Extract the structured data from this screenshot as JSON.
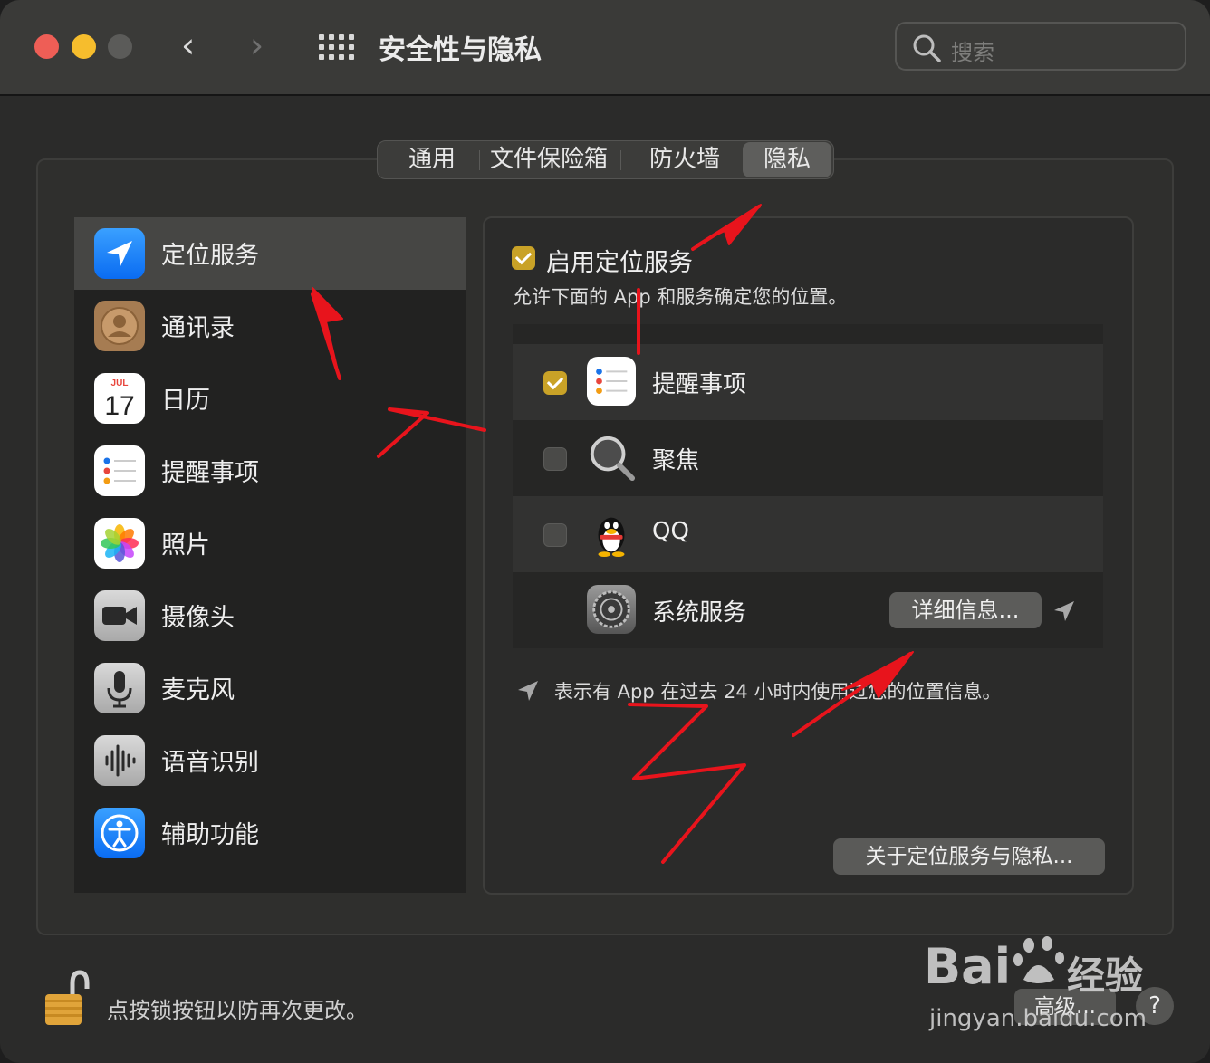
{
  "window": {
    "title": "安全性与隐私",
    "search_placeholder": "搜索"
  },
  "nav": {
    "back": "‹",
    "forward": "›"
  },
  "tabs": [
    {
      "label": "通用",
      "active": false
    },
    {
      "label": "文件保险箱",
      "active": false
    },
    {
      "label": "防火墙",
      "active": false
    },
    {
      "label": "隐私",
      "active": true
    }
  ],
  "sidebar": {
    "items": [
      {
        "label": "定位服务",
        "icon": "location-icon",
        "selected": true
      },
      {
        "label": "通讯录",
        "icon": "contacts-icon"
      },
      {
        "label": "日历",
        "icon": "calendar-icon",
        "month": "JUL",
        "day": "17"
      },
      {
        "label": "提醒事项",
        "icon": "reminders-icon"
      },
      {
        "label": "照片",
        "icon": "photos-icon"
      },
      {
        "label": "摄像头",
        "icon": "camera-icon"
      },
      {
        "label": "麦克风",
        "icon": "microphone-icon"
      },
      {
        "label": "语音识别",
        "icon": "speech-recognition-icon"
      },
      {
        "label": "辅助功能",
        "icon": "accessibility-icon"
      }
    ]
  },
  "location": {
    "enable_label": "启用定位服务",
    "enable_checked": true,
    "description": "允许下面的 App 和服务确定您的位置。",
    "apps": [
      {
        "name": "提醒事项",
        "checked": true,
        "icon": "reminders-icon"
      },
      {
        "name": "聚焦",
        "checked": false,
        "icon": "spotlight-icon"
      },
      {
        "name": "QQ",
        "checked": false,
        "icon": "qq-icon"
      },
      {
        "name": "系统服务",
        "icon": "system-preferences-icon",
        "button": "详细信息..."
      }
    ],
    "legend": "表示有 App 在过去 24 小时内使用过您的位置信息。",
    "about_button": "关于定位服务与隐私..."
  },
  "footer": {
    "lock_text": "点按锁按钮以防再次更改。",
    "advanced_button": "高级...",
    "help": "?"
  },
  "watermark": {
    "brand": "Bai",
    "suffix": "经验",
    "url": "jingyan.baidu.com"
  },
  "colors": {
    "accent_checkbox": "#c9a227",
    "annotation": "#e8141c"
  }
}
